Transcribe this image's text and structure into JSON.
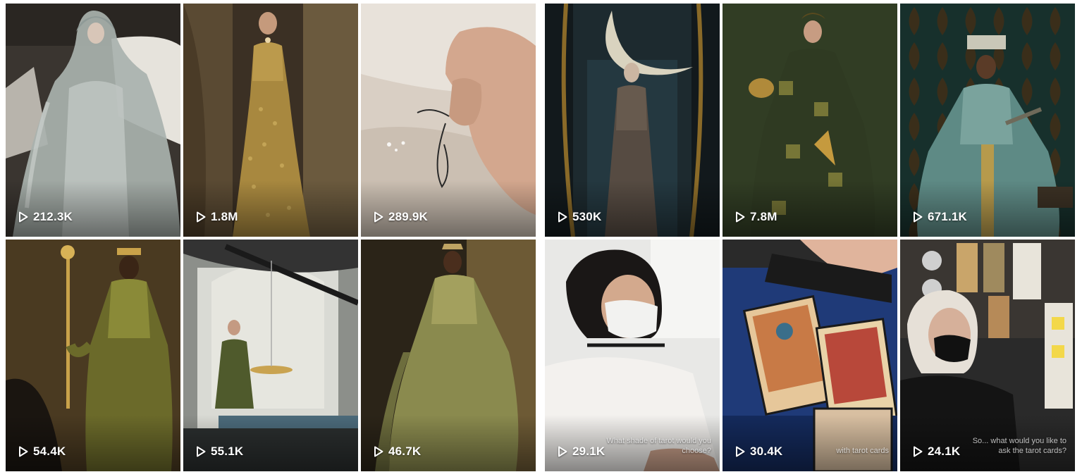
{
  "panels": [
    {
      "tiles": [
        {
          "views": "212.3K",
          "scene": "woman-sheer-grey-hooded-gown-white-horse",
          "play_icon": "play-icon"
        },
        {
          "views": "1.8M",
          "scene": "woman-gold-embellished-gown-pearl-necklace",
          "play_icon": "play-icon"
        },
        {
          "views": "289.9K",
          "scene": "hand-sewing-beads-on-tulle",
          "play_icon": "play-icon"
        }
      ]
    },
    {
      "tiles": [
        {
          "views": "54.4K",
          "scene": "woman-gold-robe-holding-sceptre",
          "play_icon": "play-icon"
        },
        {
          "views": "55.1K",
          "scene": "woman-green-dress-scales-white-throne",
          "play_icon": "play-icon"
        },
        {
          "views": "46.7K",
          "scene": "woman-crown-olive-cape",
          "play_icon": "play-icon"
        }
      ]
    },
    {
      "tiles": [
        {
          "views": "530K",
          "scene": "woman-crescent-moon-headpiece-dark-gown",
          "play_icon": "play-icon"
        },
        {
          "views": "7.8M",
          "scene": "woman-green-gold-robe-pouring-jug",
          "play_icon": "play-icon"
        },
        {
          "views": "671.1K",
          "scene": "woman-crown-teal-robe-holding-key",
          "play_icon": "play-icon"
        }
      ]
    },
    {
      "tiles": [
        {
          "views": "29.1K",
          "scene": "woman-mask-white-blouse-studio",
          "caption": "What shade of tarot would you choose?",
          "play_icon": "play-icon"
        },
        {
          "views": "30.4K",
          "scene": "hand-laying-tarot-cards",
          "caption": "with tarot cards",
          "play_icon": "play-icon"
        },
        {
          "views": "24.1K",
          "scene": "woman-black-mask-tarot-moodboard",
          "caption": "So... what would you like to ask the tarot cards?",
          "play_icon": "play-icon"
        }
      ]
    }
  ]
}
